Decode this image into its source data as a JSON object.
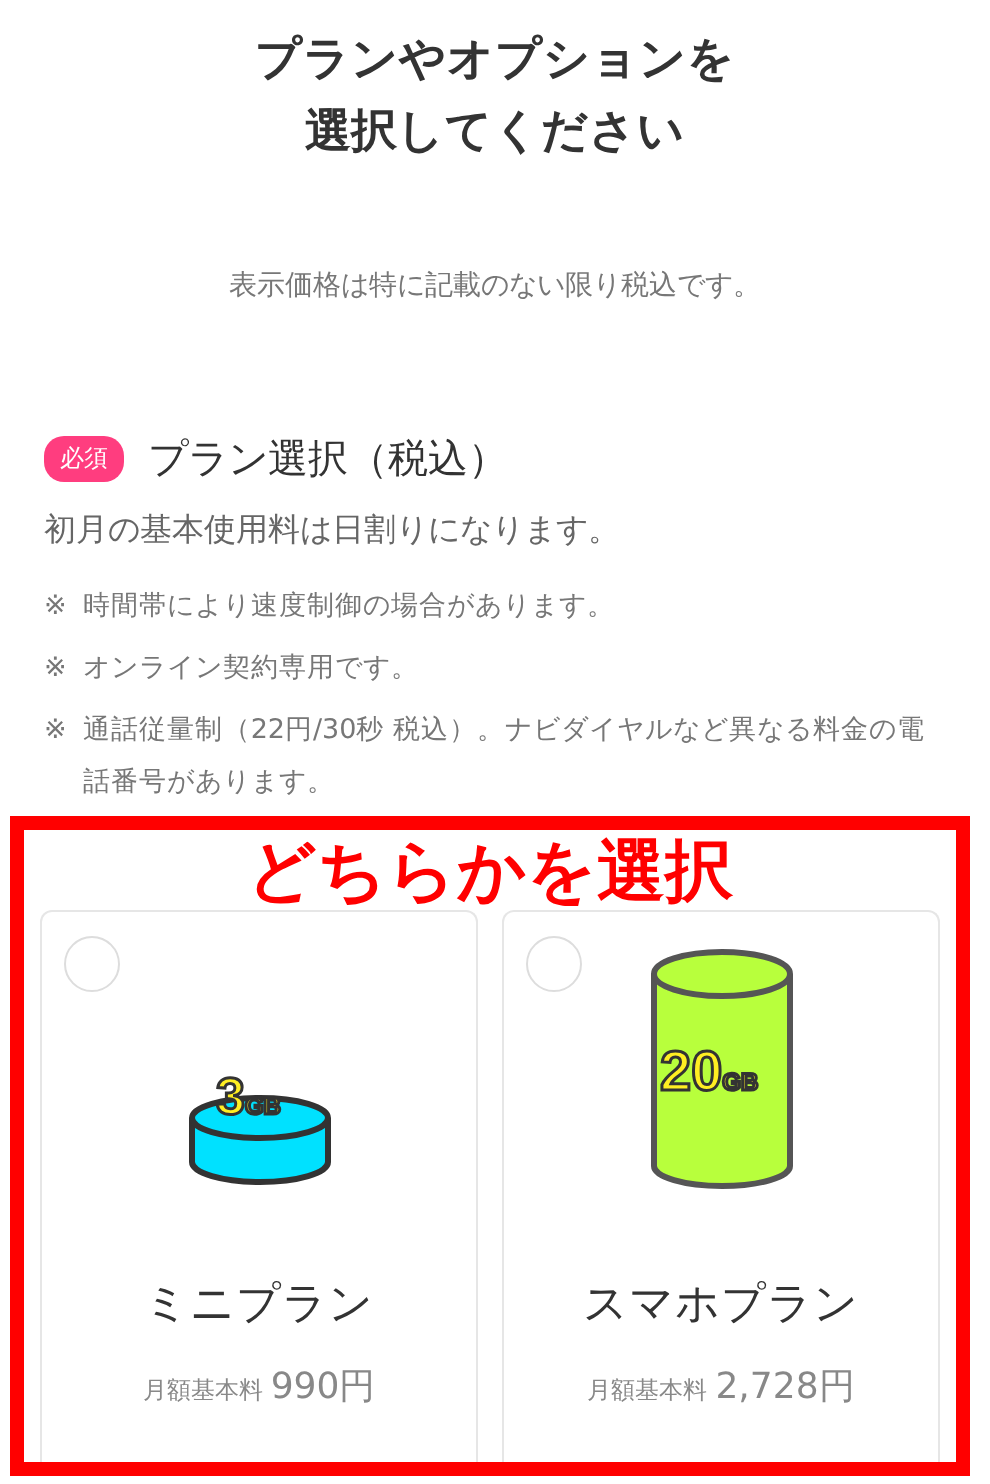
{
  "heading": [
    "プランやオプションを",
    "選択してください"
  ],
  "tax_note": "表示価格は特に記載のない限り税込です。",
  "section": {
    "badge": "必須",
    "title": "プラン選択（税込）",
    "lead": "初月の基本使用料は日割りになります。",
    "notes": [
      {
        "mark": "※",
        "text": "時間帯により速度制御の場合があります。"
      },
      {
        "mark": "※",
        "text": "オンライン契約専用です。"
      },
      {
        "mark": "※",
        "text": "通話従量制（22円/30秒 税込）。ナビダイヤルなど異なる料金の電話番号があります。"
      }
    ]
  },
  "callout": "どちらかを選択",
  "plans": [
    {
      "kind": "small",
      "selected": false,
      "capacity": "3",
      "unit": "GB",
      "color": "#00e1ff",
      "name": "ミニプラン",
      "price_label": "月額基本料",
      "price": "990円"
    },
    {
      "kind": "tall",
      "selected": false,
      "capacity": "20",
      "unit": "GB",
      "color": "#b8ff3c",
      "name": "スマホプラン",
      "price_label": "月額基本料",
      "price": "2,728円"
    }
  ]
}
